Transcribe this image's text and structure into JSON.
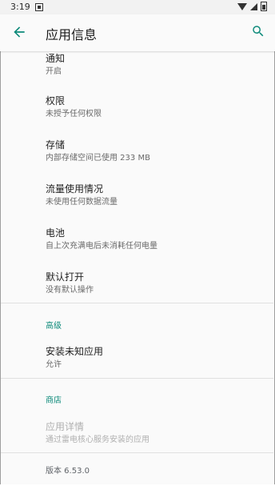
{
  "status_bar": {
    "time": "3:19",
    "icons": [
      "notification-icon",
      "wifi-icon",
      "signal-icon",
      "battery-icon"
    ]
  },
  "toolbar": {
    "title": "应用信息",
    "back_icon": "arrow-back-icon",
    "search_icon": "search-icon"
  },
  "items": [
    {
      "title": "通知",
      "subtitle": "开启"
    },
    {
      "title": "权限",
      "subtitle": "未授予任何权限"
    },
    {
      "title": "存储",
      "subtitle": "内部存储空间已使用 233 MB"
    },
    {
      "title": "流量使用情况",
      "subtitle": "未使用任何数据流量"
    },
    {
      "title": "电池",
      "subtitle": "自上次充满电后未消耗任何电量"
    },
    {
      "title": "默认打开",
      "subtitle": "没有默认操作"
    }
  ],
  "advanced": {
    "header": "高级",
    "items": [
      {
        "title": "安装未知应用",
        "subtitle": "允许"
      }
    ]
  },
  "store": {
    "header": "商店",
    "items": [
      {
        "title": "应用详情",
        "subtitle": "通过雷电核心服务安装的应用",
        "enabled": false
      }
    ]
  },
  "version": "版本 6.53.0",
  "colors": {
    "accent": "#0d8a7a",
    "background": "#fafafa",
    "divider": "#e0e0e0"
  }
}
